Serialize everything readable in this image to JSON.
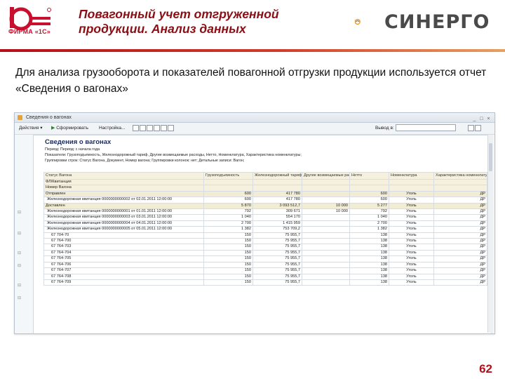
{
  "slide": {
    "title": "Повагонный учет отгруженной продукции. Анализ данных",
    "subtitle": "Для анализа грузооборота и показателей повагонной отгрузки продукции используется отчет «Сведения о вагонах»",
    "page_number": "62",
    "logo_left_text": "ФИРМА «1С»",
    "logo_right_text": "СИНЕРГО",
    "colors": {
      "title": "#8a0e14",
      "accent": "#b40f16",
      "page_number": "#b0101a"
    }
  },
  "window": {
    "title": "Сведения о вагонах",
    "toolbar": {
      "actions_label": "Действия",
      "generate_label": "Сформировать",
      "settings_label": "Настройка...",
      "right_label": "Вывод в:"
    }
  },
  "report": {
    "title": "Сведения о вагонах",
    "meta_lines": [
      "Период: Период: с начала года",
      "Показатели: Грузоподъемность, Железнодорожный тариф, Другие возмещаемые расходы, Нетто, Номенклатура, Характеристика номенклатуры;",
      "Группировки строк: Статус Вагона, Документ, Номер вагона; Группировки колонок: нет; Детальные записи: Вагон;"
    ],
    "group_labels": [
      "Статус Вагона",
      "ФЛ/Квитанция",
      "Номер Вагона"
    ],
    "columns": [
      "",
      "Грузоподъемность",
      "Железнодорожный тариф",
      "Другие возмещаемые расходы",
      "Нетто",
      "Номенклатура",
      "Характеристика номенклатуры"
    ],
    "rows": [
      {
        "kind": "sec",
        "name": "Отправлен",
        "cap": "600",
        "tariff": "417 780",
        "other": "",
        "net": "600",
        "nom": "Уголь",
        "char": "ДР"
      },
      {
        "kind": "doc",
        "name": "Железнодорожная квитанция 0000000000002 от 02.01.2011 12:00:00",
        "cap": "600",
        "tariff": "417 780",
        "other": "",
        "net": "600",
        "nom": "Уголь",
        "char": "ДР"
      },
      {
        "kind": "sec",
        "name": "Доставлен",
        "cap": "5 870",
        "tariff": "3 093 512,7",
        "other": "10 000",
        "net": "5 277",
        "nom": "Уголь",
        "char": "ДР"
      },
      {
        "kind": "doc",
        "name": "Железнодорожная квитанция 0000000000001 от 01.01.2011 12:00:00",
        "cap": "792",
        "tariff": "309 671",
        "other": "10 000",
        "net": "792",
        "nom": "Уголь",
        "char": "ДР"
      },
      {
        "kind": "doc",
        "name": "Железнодорожная квитанция 0000000000003 от 03.01.2011 12:00:00",
        "cap": "1 040",
        "tariff": "554 170",
        "other": "",
        "net": "1 040",
        "nom": "Уголь",
        "char": "ДР"
      },
      {
        "kind": "doc",
        "name": "Железнодорожная квитанция 0000000000004 от 04.01.2011 12:00:00",
        "cap": "2 700",
        "tariff": "1 415 959",
        "other": "",
        "net": "2 700",
        "nom": "Уголь",
        "char": "ДР"
      },
      {
        "kind": "doc",
        "name": "Железнодорожная квитанция 0000000000005 от 05.01.2011 12:00:00",
        "cap": "1 382",
        "tariff": "753 709,2",
        "other": "",
        "net": "1 382",
        "nom": "Уголь",
        "char": "ДР"
      },
      {
        "kind": "car",
        "name": "67 704-70",
        "cap": "150",
        "tariff": "75 955,7",
        "other": "",
        "net": "138",
        "nom": "Уголь",
        "char": "ДР"
      },
      {
        "kind": "car",
        "name": "67 764-700",
        "cap": "150",
        "tariff": "75 955,7",
        "other": "",
        "net": "138",
        "nom": "Уголь",
        "char": "ДР"
      },
      {
        "kind": "car",
        "name": "67 764-703",
        "cap": "150",
        "tariff": "75 955,7",
        "other": "",
        "net": "138",
        "nom": "Уголь",
        "char": "ДР"
      },
      {
        "kind": "car",
        "name": "67 764-704",
        "cap": "150",
        "tariff": "75 955,7",
        "other": "",
        "net": "138",
        "nom": "Уголь",
        "char": "ДР"
      },
      {
        "kind": "car",
        "name": "67 764-705",
        "cap": "150",
        "tariff": "75 955,7",
        "other": "",
        "net": "138",
        "nom": "Уголь",
        "char": "ДР"
      },
      {
        "kind": "car",
        "name": "67 764-706",
        "cap": "150",
        "tariff": "75 955,7",
        "other": "",
        "net": "138",
        "nom": "Уголь",
        "char": "ДР"
      },
      {
        "kind": "car",
        "name": "67 764-707",
        "cap": "150",
        "tariff": "75 955,7",
        "other": "",
        "net": "138",
        "nom": "Уголь",
        "char": "ДР"
      },
      {
        "kind": "car",
        "name": "67 764-708",
        "cap": "150",
        "tariff": "75 955,7",
        "other": "",
        "net": "138",
        "nom": "Уголь",
        "char": "ДР"
      },
      {
        "kind": "car",
        "name": "67 764-709",
        "cap": "150",
        "tariff": "75 955,7",
        "other": "",
        "net": "138",
        "nom": "Уголь",
        "char": "ДР"
      }
    ]
  }
}
